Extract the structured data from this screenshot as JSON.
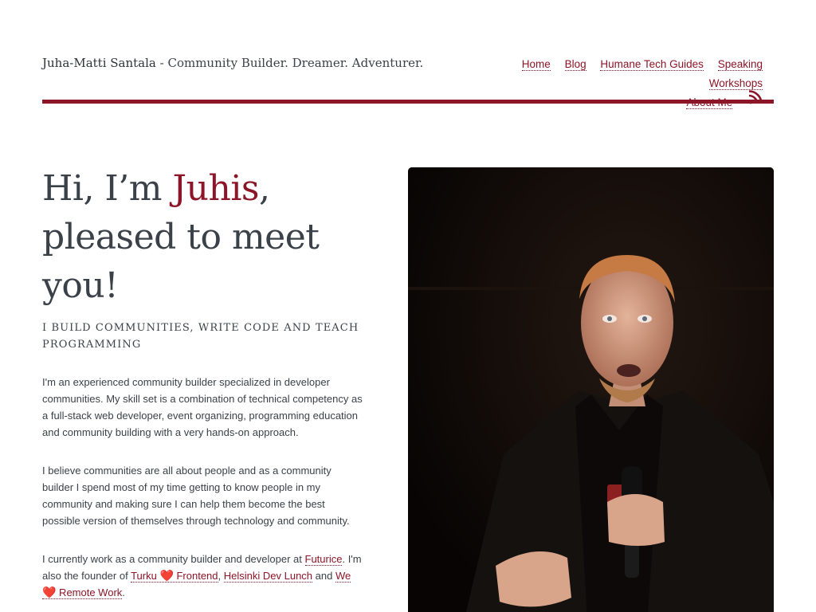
{
  "header": {
    "name": "Juha-Matti Santala",
    "separator": " - ",
    "tagline": "Community Builder. Dreamer. Adventurer."
  },
  "nav": {
    "home": "Home",
    "blog": "Blog",
    "humane": "Humane Tech Guides",
    "speaking": "Speaking",
    "workshops": "Workshops",
    "about": "About Me",
    "rss_icon": "rss-icon"
  },
  "hero": {
    "line1_pre": "Hi, I’m ",
    "line1_accent": "Juhis",
    "line1_post": ",",
    "line2": "pleased to meet",
    "line3": "you!"
  },
  "tagline": "I build communities, write code and teach programming",
  "bio": {
    "p1": "I'm an experienced community builder specialized in developer communities. My skill set is a combination of technical competency as a full-stack web developer, event organizing, programming education and community building with a very hands-on approach.",
    "p2": "I believe communities are all about people and as a community builder I spend most of my time getting to know people in my community and making sure I can help them become the best possible version of themselves through technology and community.",
    "p3_a": "I currently work as a community builder and developer at ",
    "p3_link1": "Futurice",
    "p3_b": ". I'm also the founder of ",
    "p3_link2_a": "Turku ",
    "p3_link2_b": " Frontend",
    "p3_c": ", ",
    "p3_link3": "Helsinki Dev Lunch",
    "p3_d": " and ",
    "p3_link4_a": "We ",
    "p3_link4_b": " Remote Work",
    "p3_e": ".",
    "heart": "❤️"
  },
  "colors": {
    "accent": "#8c1527",
    "text": "#3b4148"
  }
}
